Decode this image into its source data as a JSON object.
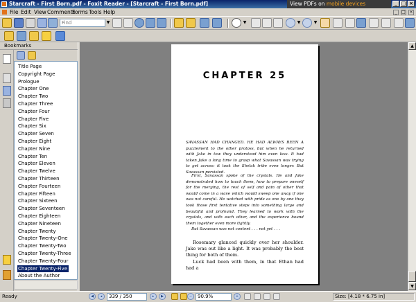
{
  "window": {
    "title": "Starcraft - First Born.pdf - Foxit Reader - [Starcraft - First Born.pdf]",
    "banner_prefix": "View PDFs on ",
    "banner_highlight": "mobile devices"
  },
  "menu": [
    "File",
    "Edit",
    "View",
    "Comments",
    "Forms",
    "Tools",
    "Help"
  ],
  "toolbar": {
    "find_placeholder": "Find"
  },
  "bookmarks": {
    "header": "Bookmarks",
    "items": [
      {
        "label": "Title Page",
        "selected": false
      },
      {
        "label": "Copyright Page",
        "selected": false
      },
      {
        "label": "Prologue",
        "selected": false
      },
      {
        "label": "Chapter One",
        "selected": false
      },
      {
        "label": "Chapter Two",
        "selected": false
      },
      {
        "label": "Chapter Three",
        "selected": false
      },
      {
        "label": "Chapter Four",
        "selected": false
      },
      {
        "label": "Chapter Five",
        "selected": false
      },
      {
        "label": "Chapter Six",
        "selected": false
      },
      {
        "label": "Chapter Seven",
        "selected": false
      },
      {
        "label": "Chapter Eight",
        "selected": false
      },
      {
        "label": "Chapter Nine",
        "selected": false
      },
      {
        "label": "Chapter Ten",
        "selected": false
      },
      {
        "label": "Chapter Eleven",
        "selected": false
      },
      {
        "label": "Chapter Twelve",
        "selected": false
      },
      {
        "label": "Chapter Thirteen",
        "selected": false
      },
      {
        "label": "Chapter Fourteen",
        "selected": false
      },
      {
        "label": "Chapter Fifteen",
        "selected": false
      },
      {
        "label": "Chapter Sixteen",
        "selected": false
      },
      {
        "label": "Chapter Seventeen",
        "selected": false
      },
      {
        "label": "Chapter Eighteen",
        "selected": false
      },
      {
        "label": "Chapter Nineteen",
        "selected": false
      },
      {
        "label": "Chapter Twenty",
        "selected": false
      },
      {
        "label": "Chapter Twenty-One",
        "selected": false
      },
      {
        "label": "Chapter Twenty-Two",
        "selected": false
      },
      {
        "label": "Chapter Twenty-Three",
        "selected": false
      },
      {
        "label": "Chapter Twenty-Four",
        "selected": false
      },
      {
        "label": "Chapter Twenty-Five",
        "selected": true
      },
      {
        "label": "About the Author",
        "selected": false
      }
    ]
  },
  "document": {
    "chapter_title": "CHAPTER 25",
    "p1": "SAVASSAN HAD CHANGED. HE HAD ALWAYS BEEN A puzzlement to the other protoss, but when he returned with Jake in tow they understood him even less. It had taken Jake a long time to grasp what Savassan was trying to get across: it took the Shelak tribe even longer. But Savassan persisted.",
    "p2": "First, Savassan spoke of the crystals. He and Jake demonstrated how to touch them, how to prepare oneself for the merging, the rest of self and pain of other that would come in a wave which would sweep one away if one was not careful. He watched with pride as one by one they took those first tentative steps into something large and beautiful and profound. They learned to work with the crystals, and with each other, and the experience bound them together even more tightly.",
    "p3": "But Savassan was not content . . . not yet . . .",
    "p4": "Rosemary glanced quickly over her shoulder. Jake was out like a light. It was probably the best thing for both of them.",
    "p5": "Luck had been with them, in that Ethan had had a"
  },
  "status": {
    "ready": "Ready",
    "page": "339 / 350",
    "zoom": "90.9%",
    "size": "Size: [4.18 * 6.75 in]"
  }
}
